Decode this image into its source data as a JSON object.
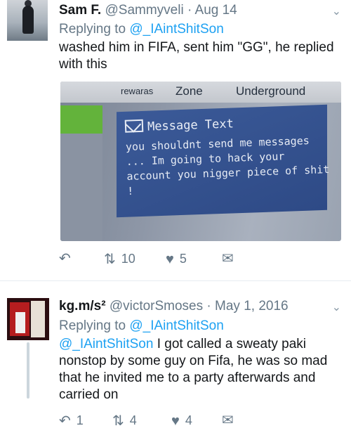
{
  "tweet1": {
    "name": "Sam F.",
    "handle": "@Sammyveli",
    "dot": "·",
    "date": "Aug 14",
    "replying_prefix": "Replying to",
    "replying_handle": "@_IAintShitSon",
    "text": "washed him in FIFA, sent him \"GG\", he replied with this",
    "photo": {
      "tab_cut": "rewaras",
      "tab_zone": "Zone",
      "tab_underground": "Underground",
      "message_title": "Message Text",
      "message_body": "you shouldnt send me messages ... Im going to hack your account you nigger piece of shit !"
    },
    "actions": {
      "retweets": "10",
      "likes": "5"
    }
  },
  "tweet2": {
    "name": "kg.m/s²",
    "handle": "@victorSmoses",
    "dot": "·",
    "date": "May 1, 2016",
    "replying_prefix": "Replying to",
    "replying_handle": "@_IAintShitSon",
    "mention": "@_IAintShitSon",
    "text": "I got called a sweaty paki nonstop by some guy on Fifa, he was so mad that he invited me to a party afterwards and carried on",
    "actions": {
      "replies": "1",
      "retweets": "4",
      "likes": "4"
    }
  },
  "icons": {
    "reply": "reply-icon",
    "retweet": "retweet-icon",
    "like": "heart-icon",
    "dm": "envelope-icon",
    "more": "chevron-down-icon"
  },
  "colors": {
    "link": "#1da1f2",
    "muted": "#657786"
  }
}
